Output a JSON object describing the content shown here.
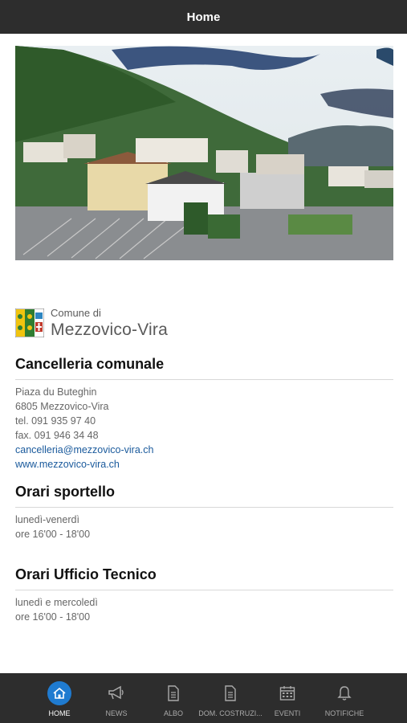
{
  "header": {
    "title": "Home"
  },
  "logo": {
    "small": "Comune di",
    "big": "Mezzovico-Vira"
  },
  "cancelleria": {
    "title": "Cancelleria comunale",
    "lines": [
      "Piaza du Buteghin",
      "6805 Mezzovico-Vira",
      "tel. 091 935 97 40",
      "fax. 091 946 34 48"
    ],
    "email": "cancelleria@mezzovico-vira.ch",
    "website": "www.mezzovico-vira.ch"
  },
  "sportello": {
    "title": "Orari sportello",
    "days": "lunedì-venerdì",
    "hours": "ore 16'00 - 18'00"
  },
  "ufficio": {
    "title": "Orari Ufficio Tecnico",
    "days": "lunedì e mercoledì",
    "hours": "ore 16'00 - 18'00"
  },
  "tabs": [
    {
      "label": "HOME",
      "icon": "home-icon",
      "active": true
    },
    {
      "label": "NEWS",
      "icon": "megaphone-icon"
    },
    {
      "label": "ALBO",
      "icon": "document-icon"
    },
    {
      "label": "DOM. COSTRUZI...",
      "icon": "document-icon"
    },
    {
      "label": "EVENTI",
      "icon": "calendar-icon"
    },
    {
      "label": "NOTIFICHE",
      "icon": "bell-icon"
    }
  ],
  "colors": {
    "bar": "#2d2d2d",
    "accent": "#1f7bd0",
    "link": "#1a5a9c"
  }
}
